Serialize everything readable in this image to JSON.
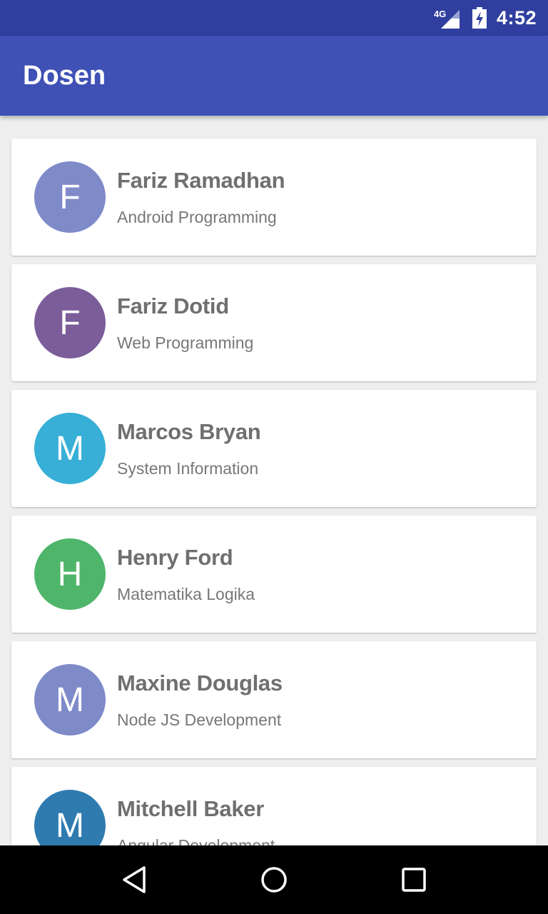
{
  "status_bar": {
    "network": "4G",
    "time": "4:52"
  },
  "app_bar": {
    "title": "Dosen"
  },
  "lecturers": [
    {
      "initial": "F",
      "name": "Fariz Ramadhan",
      "course": "Android Programming",
      "color": "#7f8ac9"
    },
    {
      "initial": "F",
      "name": "Fariz Dotid",
      "course": "Web Programming",
      "color": "#7b5d9a"
    },
    {
      "initial": "M",
      "name": "Marcos Bryan",
      "course": "System Information",
      "color": "#37afd6"
    },
    {
      "initial": "H",
      "name": "Henry Ford",
      "course": "Matematika Logika",
      "color": "#4fb56b"
    },
    {
      "initial": "M",
      "name": "Maxine Douglas",
      "course": "Node JS Development",
      "color": "#7f8ac9"
    },
    {
      "initial": "M",
      "name": "Mitchell Baker",
      "course": "Angular Development",
      "color": "#2f7bb0"
    }
  ],
  "colors": {
    "status_bar": "#303f9f",
    "app_bar": "#3f51b5",
    "background": "#eeeeee"
  },
  "nav_icons": [
    "back-icon",
    "home-icon",
    "recents-icon"
  ]
}
